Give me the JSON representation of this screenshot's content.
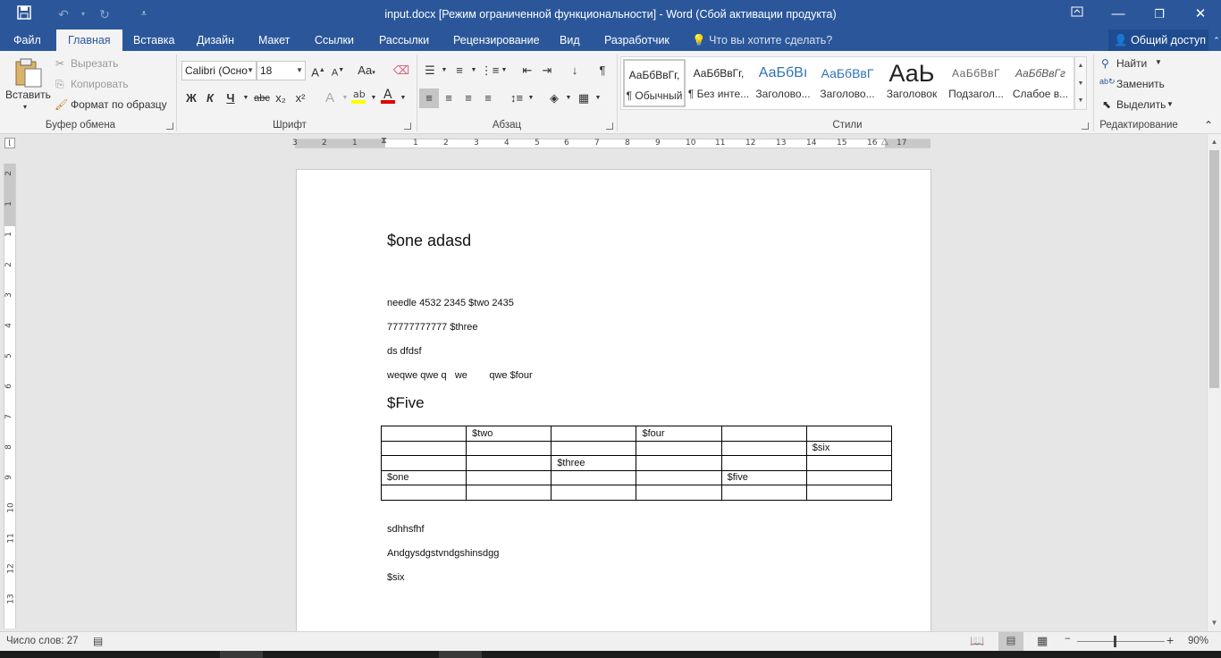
{
  "window": {
    "title": "input.docx [Режим ограниченной функциональности] - Word (Сбой активации продукта)"
  },
  "tabs": [
    "Файл",
    "Главная",
    "Вставка",
    "Дизайн",
    "Макет",
    "Ссылки",
    "Рассылки",
    "Рецензирование",
    "Вид",
    "Разработчик"
  ],
  "tell_me": "Что вы хотите сделать?",
  "share": "Общий доступ",
  "ribbon": {
    "clipboard": {
      "paste": "Вставить",
      "cut": "Вырезать",
      "copy": "Копировать",
      "format_painter": "Формат по образцу",
      "label": "Буфер обмена"
    },
    "font": {
      "name": "Calibri (Осно",
      "size": "18",
      "bold": "Ж",
      "italic": "К",
      "underline": "Ч",
      "strike": "abc",
      "sub": "x₂",
      "sup": "x²",
      "grow": "A",
      "shrink": "A",
      "case": "Aa",
      "label": "Шрифт"
    },
    "paragraph": {
      "label": "Абзац"
    },
    "styles": {
      "items": [
        {
          "preview": "АаБбВвГг,",
          "name": "¶ Обычный"
        },
        {
          "preview": "АаБбВвГг,",
          "name": "¶ Без инте..."
        },
        {
          "preview": "АаБбВı",
          "name": "Заголово..."
        },
        {
          "preview": "АаБбВвГ",
          "name": "Заголово..."
        },
        {
          "preview": "АаЬ",
          "name": "Заголовок"
        },
        {
          "preview": "АаБбВвГ",
          "name": "Подзагол..."
        },
        {
          "preview": "АаБбВвГг",
          "name": "Слабое в..."
        }
      ],
      "label": "Стили"
    },
    "editing": {
      "find": "Найти",
      "replace": "Заменить",
      "select": "Выделить",
      "label": "Редактирование"
    }
  },
  "ruler": {
    "h_ticks": [
      "3",
      "2",
      "1",
      "1",
      "2",
      "3",
      "4",
      "5",
      "6",
      "7",
      "8",
      "9",
      "10",
      "11",
      "12",
      "13",
      "14",
      "15",
      "16",
      "17"
    ],
    "v_ticks": [
      "2",
      "1",
      "1",
      "2",
      "3",
      "4",
      "5",
      "6",
      "7",
      "8",
      "9",
      "10",
      "11",
      "12",
      "13"
    ]
  },
  "document": {
    "heading1": "$one adasd",
    "lines": [
      "needle 4532 2345 $two 2435",
      "77777777777 $three",
      "ds dfdsf",
      "weqwe qwe q   we        qwe $four"
    ],
    "heading2": "$Five",
    "table": [
      [
        "",
        "$two",
        "",
        "$four",
        "",
        ""
      ],
      [
        "",
        "",
        "",
        "",
        "",
        "$six"
      ],
      [
        "",
        "",
        "$three",
        "",
        "",
        ""
      ],
      [
        "$one",
        "",
        "",
        "",
        "$five",
        ""
      ],
      [
        "",
        "",
        "",
        "",
        "",
        ""
      ]
    ],
    "after": [
      "sdhhsfhf",
      "Andgysdgstvndgshinsdgg",
      "$six"
    ]
  },
  "status": {
    "word_count": "Число слов: 27",
    "zoom": "90%"
  },
  "colors": {
    "accent": "#2b579a",
    "highlight": "#ffff00",
    "font_color": "#ff0000"
  }
}
